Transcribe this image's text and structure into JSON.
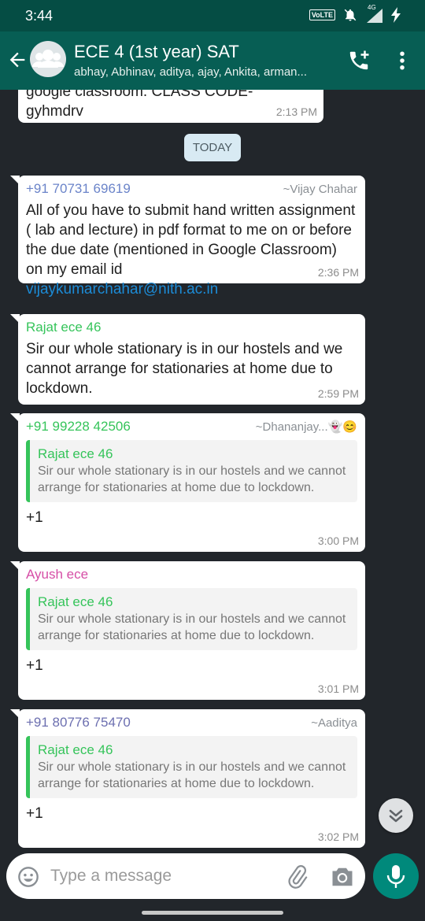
{
  "status_bar": {
    "time": "3:44",
    "volte": "VoLTE",
    "network": "4G"
  },
  "header": {
    "title": "ECE 4 (1st year) SAT",
    "subtitle": "abhay, Abhinav, aditya, ajay, Ankita, arman..."
  },
  "messages": [
    {
      "text_top": "google classroom. CLASS CODE-",
      "text": "gyhmdrv",
      "time": "2:13 PM"
    },
    {
      "sender": "+91 70731 69619",
      "sender_color": "#6b84c9",
      "alias": "~Vijay Chahar",
      "text": "All of you have to submit hand written assignment ( lab and lecture) in pdf format to me on or before the due date (mentioned in Google Classroom) on my email id",
      "link": "vijaykumarchahar@nith.ac.in",
      "time": "2:36 PM"
    },
    {
      "sender": "Rajat ece 46",
      "sender_color": "#35c45a",
      "text": "Sir our whole stationary is in our hostels and we cannot arrange for stationaries at home due to lockdown.",
      "time": "2:59 PM"
    },
    {
      "sender": "+91 99228 42506",
      "sender_color": "#35c45a",
      "alias": "~Dhananjay...👻😊",
      "quote_name": "Rajat ece 46",
      "quote_text": "Sir our whole stationary is in our hostels and we cannot arrange for stationaries at home due to lockdown.",
      "text": "+1",
      "time": "3:00 PM"
    },
    {
      "sender": "Ayush ece",
      "sender_color": "#d64ea6",
      "quote_name": "Rajat ece 46",
      "quote_text": "Sir our whole stationary is in our hostels and we cannot arrange for stationaries at home due to lockdown.",
      "text": "+1",
      "time": "3:01 PM"
    },
    {
      "sender": "+91 80776 75470",
      "sender_color": "#6c6fb0",
      "alias": "~Aaditya",
      "quote_name": "Rajat ece 46",
      "quote_text": "Sir our whole stationary is in our hostels and we cannot arrange for stationaries at home due to lockdown.",
      "text": "+1",
      "time": "3:02 PM"
    }
  ],
  "date_chip": "TODAY",
  "composer": {
    "placeholder": "Type a message"
  },
  "colors": {
    "header": "#075e54",
    "chat_bg": "#22262b",
    "accent": "#00897b"
  },
  "icons": [
    "back-arrow-icon",
    "group-avatar-icon",
    "add-call-icon",
    "more-vert-icon",
    "emoji-icon",
    "attach-icon",
    "camera-icon",
    "mic-icon",
    "chevron-double-down-icon"
  ]
}
